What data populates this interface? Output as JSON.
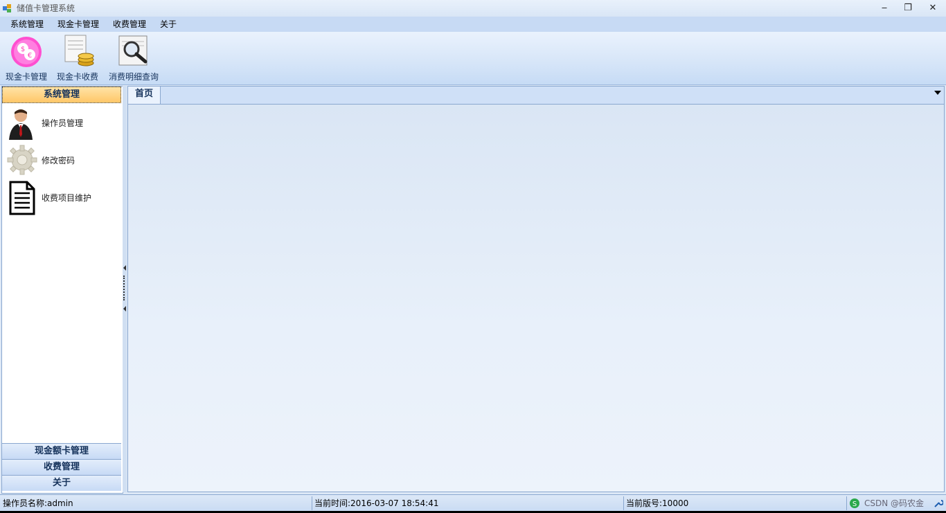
{
  "window": {
    "title": "储值卡管理系统",
    "minimize_glyph": "‒",
    "maximize_glyph": "❐",
    "close_glyph": "✕"
  },
  "menu": {
    "items": [
      {
        "label": "系统管理"
      },
      {
        "label": "现金卡管理"
      },
      {
        "label": "收费管理"
      },
      {
        "label": "关于"
      }
    ]
  },
  "toolbar": {
    "buttons": [
      {
        "label": "现金卡管理",
        "icon": "money-flower-icon"
      },
      {
        "label": "现金卡收费",
        "icon": "receipt-coins-icon"
      },
      {
        "label": "消费明细查询",
        "icon": "magnifier-document-icon"
      }
    ]
  },
  "left_panel": {
    "header": "系统管理",
    "items": [
      {
        "label": "操作员管理",
        "icon": "user-icon"
      },
      {
        "label": "修改密码",
        "icon": "gear-icon"
      },
      {
        "label": "收费项目维护",
        "icon": "document-icon"
      }
    ],
    "footer_groups": [
      {
        "label": "现金额卡管理"
      },
      {
        "label": "收费管理"
      },
      {
        "label": "关于"
      }
    ]
  },
  "tabs": {
    "items": [
      {
        "label": "首页"
      }
    ]
  },
  "status": {
    "operator": "操作员名称:admin",
    "time": "当前时间:2016-03-07 18:54:41",
    "version": "当前版号:10000",
    "watermark": "CSDN @码农金"
  },
  "colors": {
    "header_accent": "#ffc768",
    "panel_border": "#8aa7cf",
    "menu_bg": "#c7daf4"
  }
}
